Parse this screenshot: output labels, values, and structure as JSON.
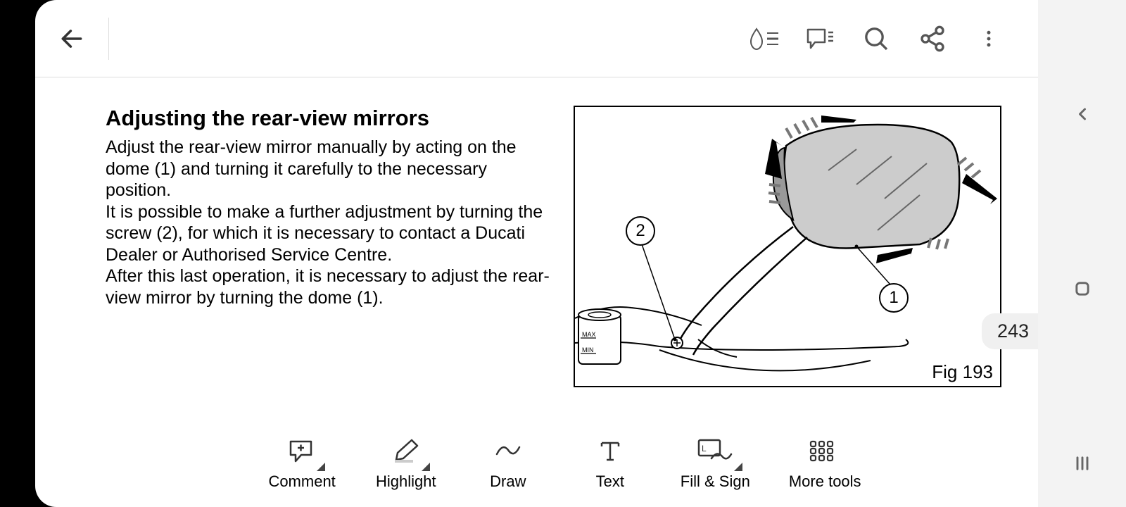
{
  "document": {
    "heading": "Adjusting the rear-view mirrors",
    "para1": "Adjust the rear-view mirror manually by acting on the dome (1) and turning it carefully to the necessary position.",
    "para2": "It is possible to make a further adjustment by turning the screw (2), for which it is necessary to contact a Ducati Dealer or Authorised Service Centre.",
    "para3": "After this last operation, it is necessary to adjust the rear-view mirror by turning the dome (1).",
    "figure_caption": "Fig 193",
    "callout_1": "1",
    "callout_2": "2",
    "reservoir_max": "MAX",
    "reservoir_min": "MIN"
  },
  "page_number": "243",
  "toolbar": {
    "comment": "Comment",
    "highlight": "Highlight",
    "draw": "Draw",
    "text": "Text",
    "fill_sign": "Fill & Sign",
    "more_tools": "More tools"
  }
}
